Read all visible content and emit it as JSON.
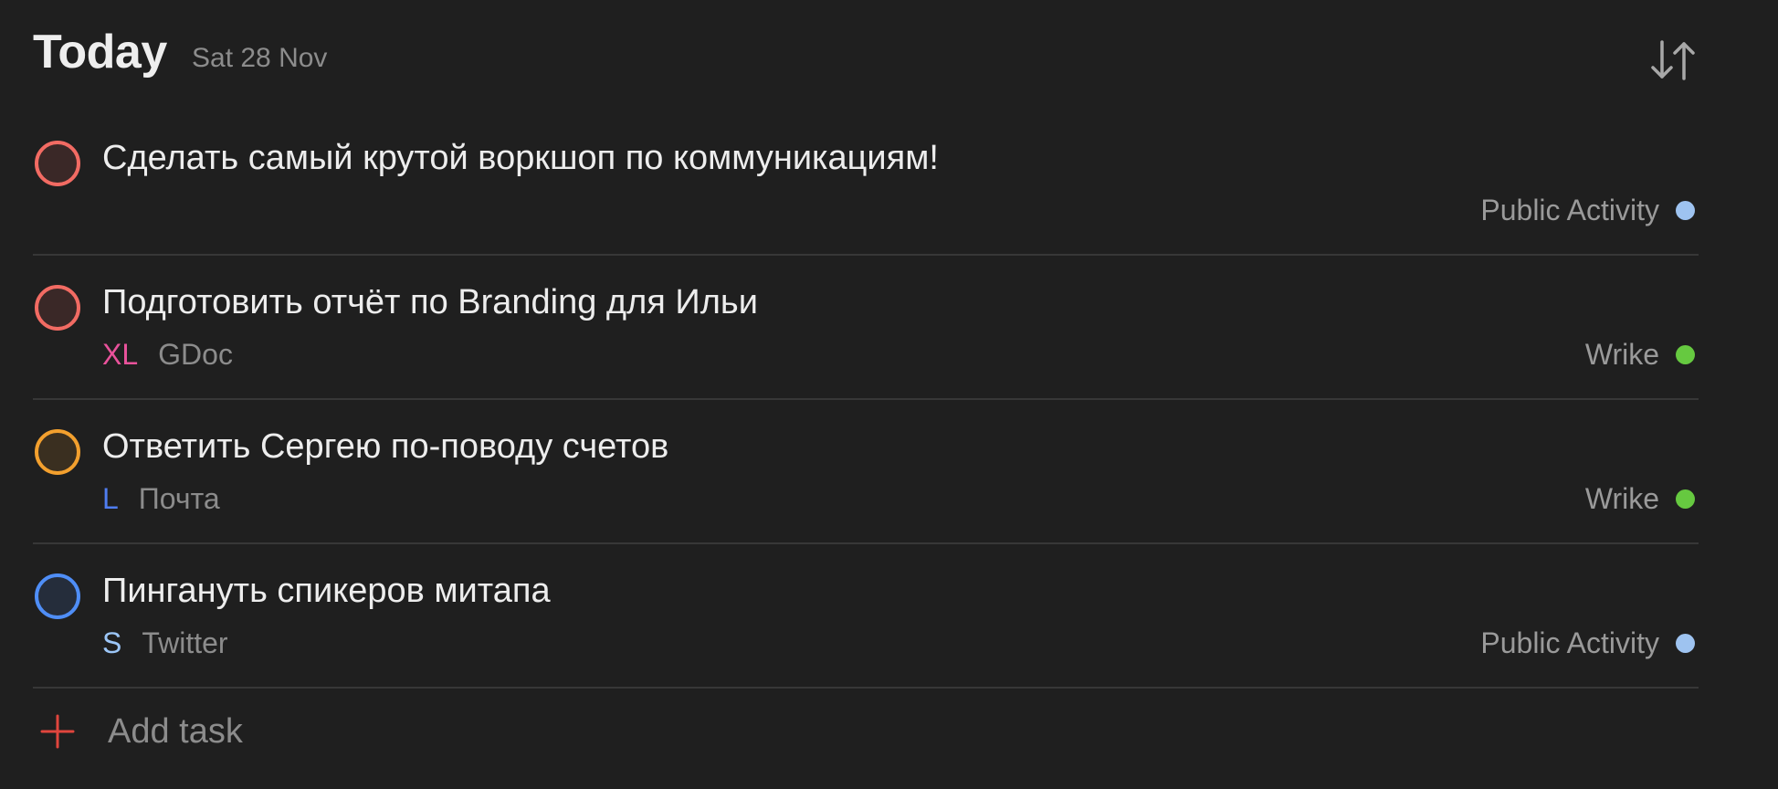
{
  "header": {
    "title": "Today",
    "date": "Sat 28 Nov",
    "sort_icon": "sort-arrows-icon"
  },
  "colors": {
    "background": "#1f1f1f",
    "priority_red": "#f26b63",
    "priority_orange": "#f3a02e",
    "priority_blue": "#4f8ef7",
    "size_xl": "#e9529b",
    "size_l": "#4f7df0",
    "size_s": "#9cc6f7",
    "project_public_activity": "#9ec3f0",
    "project_wrike": "#66c940",
    "add_icon": "#e0453d"
  },
  "tasks": [
    {
      "title": "Сделать самый крутой воркшоп по коммуникациям!",
      "priority_color": "#f26b63",
      "size": "",
      "context": "",
      "project": "Public Activity",
      "project_color": "#9ec3f0"
    },
    {
      "title": "Подготовить отчёт по Branding для Ильи",
      "priority_color": "#f26b63",
      "size": "XL",
      "size_color": "#e9529b",
      "context": "GDoc",
      "project": "Wrike",
      "project_color": "#66c940"
    },
    {
      "title": "Ответить Сергею по-поводу счетов",
      "priority_color": "#f3a02e",
      "size": "L",
      "size_color": "#4f7df0",
      "context": "Почта",
      "project": "Wrike",
      "project_color": "#66c940"
    },
    {
      "title": "Пингануть спикеров митапа",
      "priority_color": "#4f8ef7",
      "size": "S",
      "size_color": "#9cc6f7",
      "context": "Twitter",
      "project": "Public Activity",
      "project_color": "#9ec3f0"
    }
  ],
  "add_task": {
    "label": "Add task",
    "icon": "plus-icon"
  }
}
